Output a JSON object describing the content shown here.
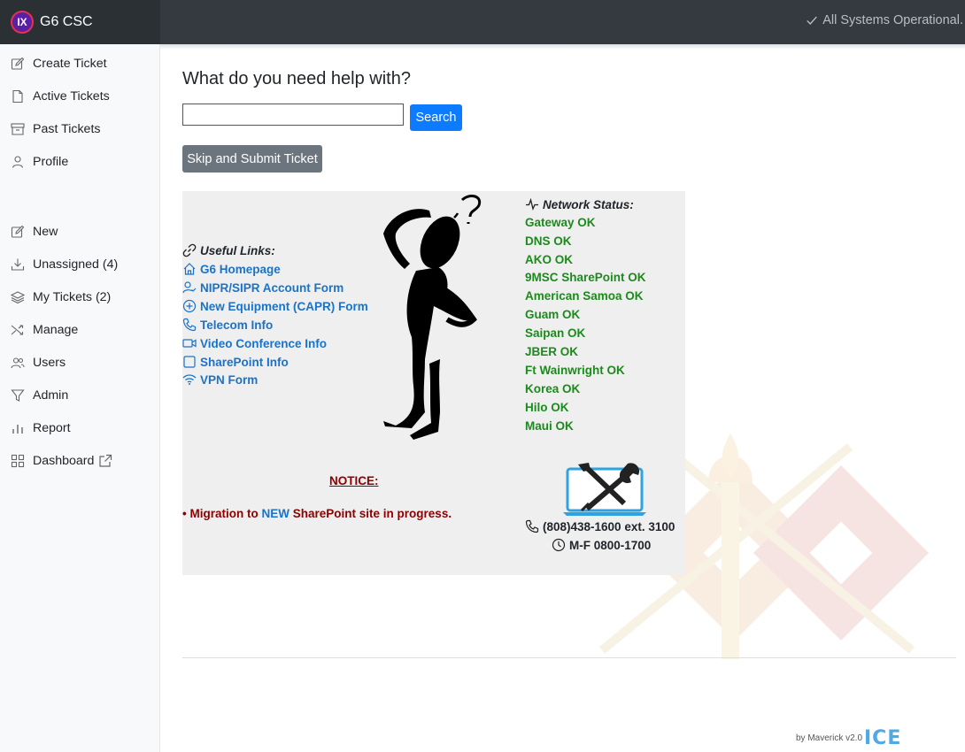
{
  "app": {
    "logo_text": "IX",
    "title": "G6 CSC"
  },
  "header": {
    "status_text": "All Systems Operational."
  },
  "sidebar": {
    "top_items": [
      {
        "label": "Create Ticket",
        "icon": "pencil-square-icon"
      },
      {
        "label": "Active Tickets",
        "icon": "file-icon"
      },
      {
        "label": "Past Tickets",
        "icon": "archive-icon"
      },
      {
        "label": "Profile",
        "icon": "person-icon"
      }
    ],
    "admin_items": [
      {
        "label": "New",
        "icon": "pencil-square-icon"
      },
      {
        "label": "Unassigned (4)",
        "icon": "download-icon"
      },
      {
        "label": "My Tickets (2)",
        "icon": "layers-icon"
      },
      {
        "label": "Manage",
        "icon": "shuffle-icon"
      },
      {
        "label": "Users",
        "icon": "people-icon"
      },
      {
        "label": "Admin",
        "icon": "funnel-icon"
      },
      {
        "label": "Report",
        "icon": "bar-chart-icon"
      },
      {
        "label": "Dashboard",
        "icon": "grid-icon"
      }
    ]
  },
  "main": {
    "question": "What do you need help with?",
    "search": {
      "value": "",
      "placeholder": "",
      "button": "Search"
    },
    "skip_button": "Skip and Submit Ticket"
  },
  "links": {
    "title": "Useful Links:",
    "items": [
      {
        "label": "G6 Homepage",
        "icon": "house-icon"
      },
      {
        "label": "NIPR/SIPR Account Form",
        "icon": "person-check-icon"
      },
      {
        "label": "New Equipment (CAPR) Form",
        "icon": "plus-circle-icon"
      },
      {
        "label": "Telecom Info",
        "icon": "phone-icon"
      },
      {
        "label": "Video Conference Info",
        "icon": "camera-video-icon"
      },
      {
        "label": "SharePoint Info",
        "icon": "square-icon"
      },
      {
        "label": "VPN Form",
        "icon": "wifi-icon"
      }
    ]
  },
  "network": {
    "title": "Network Status:",
    "items": [
      "Gateway OK",
      "DNS OK",
      "AKO OK",
      "9MSC SharePoint OK",
      "American Samoa OK",
      "Guam OK",
      "Saipan OK",
      "JBER OK",
      "Ft Wainwright OK",
      "Korea OK",
      "Hilo OK",
      "Maui OK"
    ],
    "ok_color": "#1c8a1c"
  },
  "notice": {
    "title": "NOTICE:",
    "bullet": "•",
    "prefix": "Migration to",
    "highlight": "NEW",
    "suffix": "SharePoint site in progress."
  },
  "contact": {
    "phone": "(808)438-1600 ext. 3100",
    "hours": "M-F 0800-1700"
  },
  "footer": {
    "by": "by Maverick v2.0",
    "logo": "ICE"
  },
  "colors": {
    "accent": "#0d7bff",
    "link": "#1a73c8",
    "notice": "#8b0000",
    "topbar": "#343a40"
  }
}
